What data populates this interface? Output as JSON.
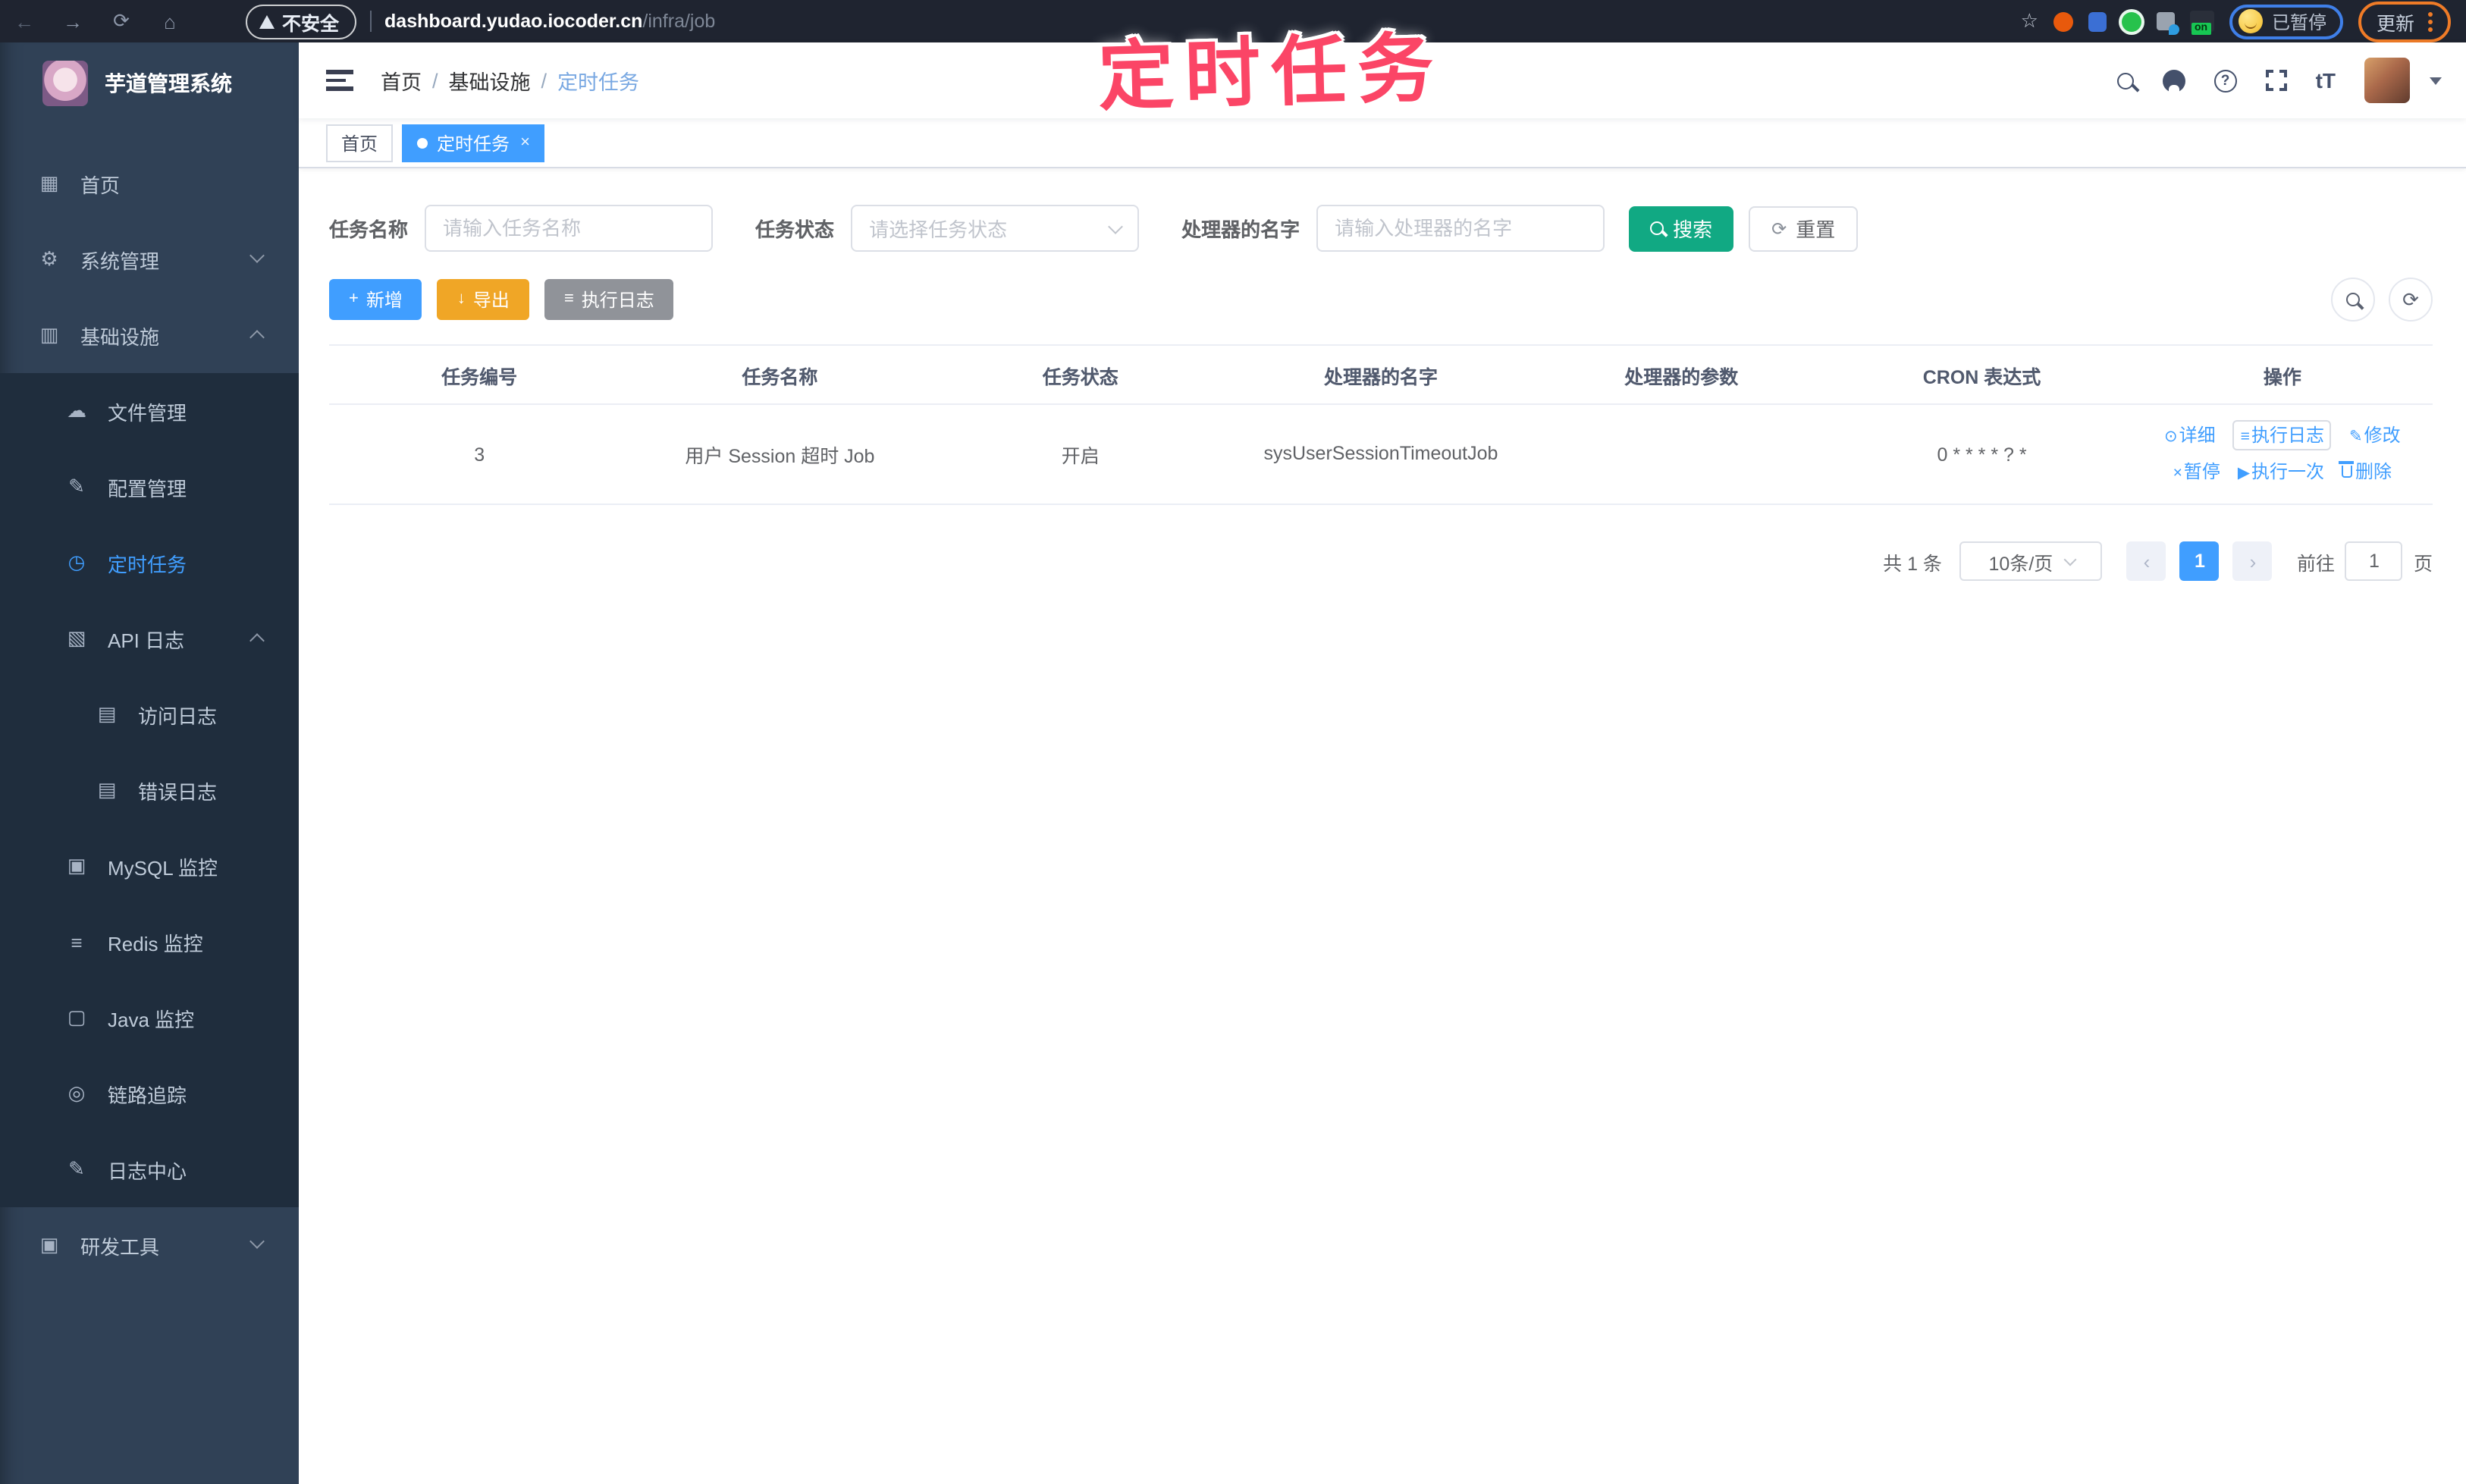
{
  "browser": {
    "security_label": "不安全",
    "url_host": "dashboard.yudao.iocoder.cn",
    "url_path": "/infra/job",
    "ext_badge": "on",
    "paused_label": "已暂停",
    "update_label": "更新"
  },
  "watermark": "定时任务",
  "sidebar": {
    "title": "芋道管理系统",
    "items": [
      {
        "label": "首页"
      },
      {
        "label": "系统管理"
      },
      {
        "label": "基础设施"
      },
      {
        "label": "文件管理"
      },
      {
        "label": "配置管理"
      },
      {
        "label": "定时任务",
        "active": true
      },
      {
        "label": "API 日志"
      },
      {
        "label": "访问日志"
      },
      {
        "label": "错误日志"
      },
      {
        "label": "MySQL 监控"
      },
      {
        "label": "Redis 监控"
      },
      {
        "label": "Java 监控"
      },
      {
        "label": "链路追踪"
      },
      {
        "label": "日志中心"
      },
      {
        "label": "研发工具"
      }
    ]
  },
  "navbar": {
    "breadcrumb": [
      "首页",
      "基础设施",
      "定时任务"
    ],
    "separator": "/",
    "font_icon_text": "tT"
  },
  "tags": [
    {
      "label": "首页",
      "active": false
    },
    {
      "label": "定时任务",
      "active": true,
      "close": "×"
    }
  ],
  "search_form": {
    "fields": [
      {
        "label": "任务名称",
        "placeholder": "请输入任务名称",
        "type": "input"
      },
      {
        "label": "任务状态",
        "placeholder": "请选择任务状态",
        "type": "select"
      },
      {
        "label": "处理器的名字",
        "placeholder": "请输入处理器的名字",
        "type": "input"
      }
    ],
    "search_label": "搜索",
    "reset_label": "重置"
  },
  "toolbar": {
    "add_label": "新增",
    "export_label": "导出",
    "exec_log_label": "执行日志"
  },
  "table": {
    "columns": [
      "任务编号",
      "任务名称",
      "任务状态",
      "处理器的名字",
      "处理器的参数",
      "CRON 表达式",
      "操作"
    ],
    "row": {
      "job_id": "3",
      "job_name": "用户 Session 超时 Job",
      "job_status": "开启",
      "handler_name": "sysUserSessionTimeoutJob",
      "handler_param": "",
      "cron": "0 * * * * ? *"
    },
    "actions": [
      {
        "label": "详细"
      },
      {
        "label": "执行日志"
      },
      {
        "label": "修改"
      },
      {
        "label": "暂停"
      },
      {
        "label": "执行一次"
      },
      {
        "label": "删除"
      }
    ]
  },
  "pagination": {
    "total_text": "共 1 条",
    "page_size_text": "10条/页",
    "prev": "‹",
    "current_page": "1",
    "next": "›",
    "goto_label": "前往",
    "goto_value": "1",
    "unit_label": "页"
  },
  "colors": {
    "primary": "#409EFF",
    "search_button": "#11A983",
    "export_button": "#F0A626",
    "info_button": "#909399",
    "watermark": "#FB4566",
    "sidebar_bg": "#304156",
    "submenu_bg": "#1F2D3D",
    "topbar_bg": "#1F2430"
  }
}
